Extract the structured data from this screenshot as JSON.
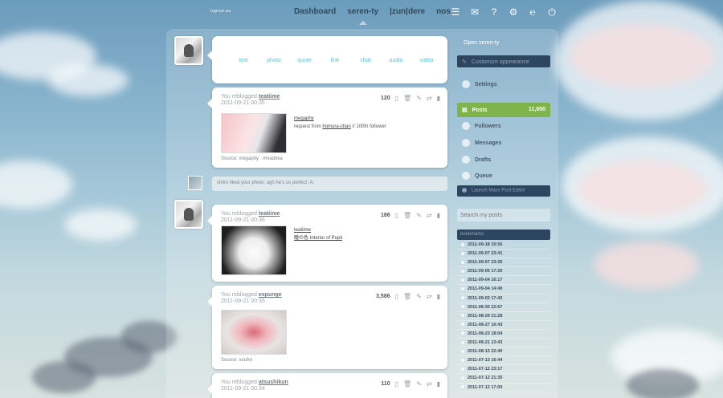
{
  "topbar": {
    "logo": "ruprue.us",
    "nav": [
      "Dashboard",
      "seren-ty",
      "|zun|dere",
      "nos"
    ],
    "active_index": 1
  },
  "composer": {
    "types": [
      "text",
      "photo",
      "quote",
      "link",
      "chat",
      "audio",
      "video"
    ]
  },
  "posts": [
    {
      "action": "You reblogged",
      "user": "teatiime",
      "timestamp": "2011-09-21 00:35",
      "notes": "120",
      "body_user": "megaphy",
      "body_prefix": "request from ",
      "body_link": "homura-chan",
      "body_suffix": " // 100th follower",
      "source_label": "Source: megaphy",
      "tag": "#madoka"
    },
    {
      "action": "You reblogged",
      "user": "teatiime",
      "timestamp": "2011-09-21 00:36",
      "notes": "186",
      "body_user": "teatiime",
      "body_text": "瞳の色 Interior of Pupil"
    },
    {
      "action": "You reblogged",
      "user": "expunge",
      "timestamp": "2011-09-21 00:35",
      "notes": "3,586",
      "source_label": "Source: soufre"
    },
    {
      "action": "You reblogged",
      "user": "atsushikun",
      "timestamp": "2011-09-21 00:34",
      "notes": "110"
    }
  ],
  "note_reply": "shiiro liked your photo: ugh he's so perfect ;A;",
  "sidebar": {
    "open_label": "Open seren-ty",
    "customize_label": "Customize appearance",
    "settings_label": "Settings",
    "posts_label": "Posts",
    "posts_count": "11,650",
    "followers_label": "Followers",
    "messages_label": "Messages",
    "drafts_label": "Drafts",
    "queue_label": "Queue",
    "launch_label": "Launch Mass Post Editor",
    "search_placeholder": "Search my posts",
    "bookmarks_label": "bookmarks",
    "bookmarks": [
      "2011-09-18 15:56",
      "2011-09-07 23:41",
      "2011-09-07 23:35",
      "2011-09-05 17:30",
      "2011-09-04 16:17",
      "2011-09-04 14:40",
      "2011-09-02 17:42",
      "2011-08-30 22:57",
      "2011-08-29 21:28",
      "2011-08-27 16:43",
      "2011-08-23 18:04",
      "2011-08-21 13:43",
      "2011-08-13 22:40",
      "2011-07-13 16:44",
      "2011-07-12 23:17",
      "2011-07-12 21:35",
      "2011-07-12 17:00"
    ]
  },
  "colors": {
    "accent_blue": "#59c5e6",
    "sidebar_dark": "#2e4560",
    "posts_green": "#7fb44d"
  }
}
